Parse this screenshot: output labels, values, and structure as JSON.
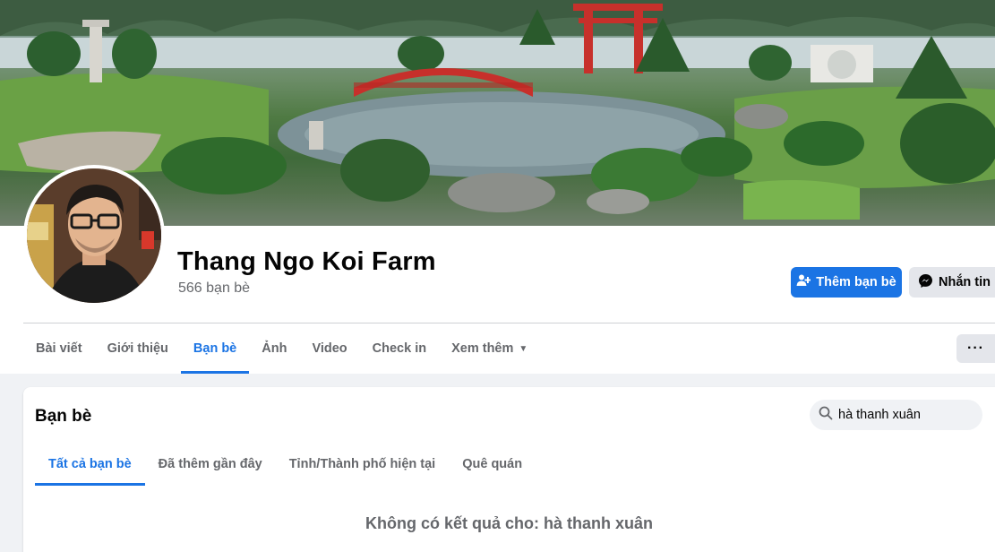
{
  "profile": {
    "name": "Thang Ngo Koi Farm",
    "friend_count": "566 bạn bè"
  },
  "actions": {
    "add_friend": "Thêm bạn bè",
    "message": "Nhắn tin",
    "more": "···"
  },
  "nav": {
    "tabs": [
      "Bài viết",
      "Giới thiệu",
      "Bạn bè",
      "Ảnh",
      "Video",
      "Check in",
      "Xem thêm"
    ],
    "active_tab": "Bạn bè"
  },
  "friends_section": {
    "title": "Bạn bè",
    "search_value": "hà thanh xuân",
    "subtabs": [
      "Tất cả bạn bè",
      "Đã thêm gần đây",
      "Tỉnh/Thành phố hiện tại",
      "Quê quán"
    ],
    "active_subtab": "Tất cả bạn bè",
    "no_results": "Không có kết quả cho: hà thanh xuân"
  },
  "colors": {
    "accent": "#1b74e4",
    "secondary_button": "#e4e6eb",
    "background": "#f0f2f5",
    "muted_text": "#65676b"
  },
  "icons": {
    "add_friend": "person-plus-icon",
    "message": "messenger-icon",
    "more_tabs": "caret-down-icon",
    "search": "search-icon"
  }
}
